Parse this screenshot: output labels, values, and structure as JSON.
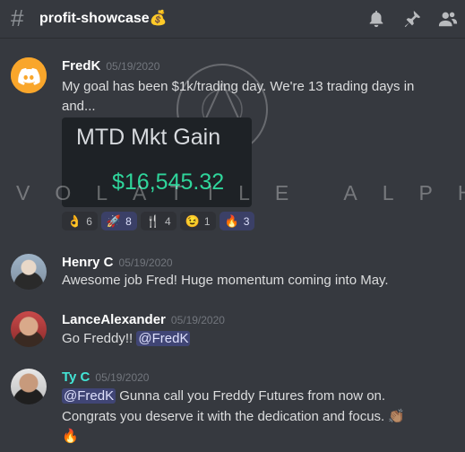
{
  "header": {
    "hash_symbol": "#",
    "channel_name": "profit-showcase💰",
    "icons": [
      "bell-icon",
      "pin-icon",
      "members-icon"
    ]
  },
  "watermark": {
    "text": "VOLATILE ALPHA"
  },
  "messages": [
    {
      "author": "FredK",
      "timestamp": "05/19/2020",
      "lines": [
        "My goal has been $1k/trading day. We're 13 trading days in",
        "and..."
      ],
      "embed": {
        "title": "MTD Mkt Gain",
        "amount": "$16,545.32"
      },
      "reactions": [
        {
          "emoji": "👌",
          "count": "6",
          "active": false
        },
        {
          "emoji": "🚀",
          "count": "8",
          "active": true
        },
        {
          "emoji": "🍴",
          "count": "4",
          "active": false
        },
        {
          "emoji": "😉",
          "count": "1",
          "active": false
        },
        {
          "emoji": "🔥",
          "count": "3",
          "active": true
        }
      ]
    },
    {
      "author": "Henry C",
      "timestamp": "05/19/2020",
      "lines": [
        "Awesome job Fred! Huge momentum coming into May."
      ]
    },
    {
      "author": "LanceAlexander",
      "timestamp": "05/19/2020",
      "text": "Go Freddy!! ",
      "mention": "@FredK"
    },
    {
      "author": "Ty C",
      "timestamp": "05/19/2020",
      "mention": "@FredK",
      "line1_rest": " Gunna call you Freddy Futures from now on.",
      "line2": "Congrats you deserve it with the dedication and focus. 👏🏽",
      "line3": "🔥"
    }
  ]
}
